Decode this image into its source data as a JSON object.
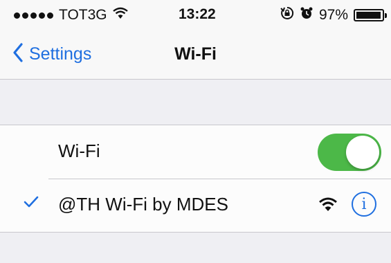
{
  "status_bar": {
    "carrier": "TOT3G",
    "time": "13:22",
    "battery_percent_label": "97%",
    "battery_level": 0.97,
    "signal_dots": 5,
    "icons": [
      "wifi-icon",
      "orientation-lock-icon",
      "alarm-icon",
      "battery-icon"
    ]
  },
  "nav": {
    "back_label": "Settings",
    "title": "Wi-Fi"
  },
  "wifi_toggle": {
    "label": "Wi-Fi",
    "on": true
  },
  "network": {
    "name": "@TH Wi-Fi by MDES",
    "connected": true,
    "info_glyph": "i"
  },
  "colors": {
    "accent": "#1f6fe0",
    "toggle_on": "#4cb848",
    "background": "#efeff3",
    "cell": "#fcfcfc"
  }
}
